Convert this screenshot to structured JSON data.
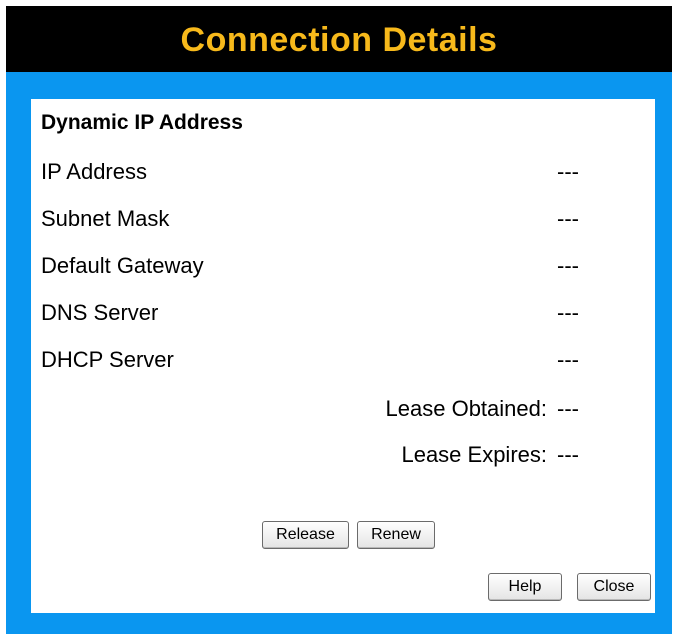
{
  "window": {
    "title": "Connection Details"
  },
  "section": {
    "heading": "Dynamic IP Address"
  },
  "rows": [
    {
      "label": "IP Address",
      "value": "---"
    },
    {
      "label": "Subnet Mask",
      "value": "---"
    },
    {
      "label": "Default Gateway",
      "value": "---"
    },
    {
      "label": "DNS Server",
      "value": "---"
    },
    {
      "label": "DHCP Server",
      "value": "---"
    }
  ],
  "lease": [
    {
      "label": "Lease Obtained:",
      "value": "---"
    },
    {
      "label": "Lease Expires:",
      "value": "---"
    }
  ],
  "buttons": {
    "release": "Release",
    "renew": "Renew",
    "help": "Help",
    "close": "Close"
  },
  "colors": {
    "title_text": "#f7b91b",
    "title_bar": "#000000",
    "frame": "#0a96f0",
    "panel": "#ffffff"
  }
}
